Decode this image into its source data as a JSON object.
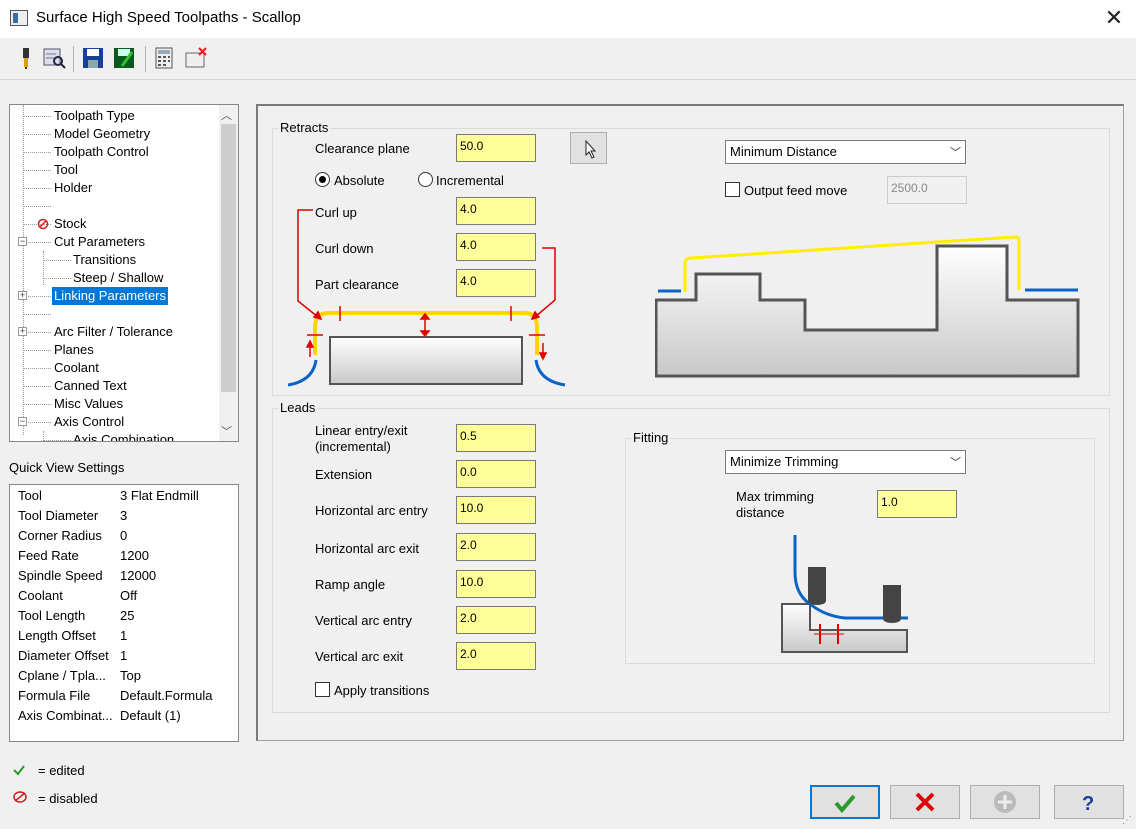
{
  "window": {
    "title": "Surface High Speed Toolpaths - Scallop",
    "close_icon": "close-icon"
  },
  "toolbar": {
    "icons": [
      "tool-icon",
      "preview-icon",
      "save-icon",
      "save-load-icon",
      "calculator-icon",
      "clear-icon"
    ]
  },
  "tree": {
    "items": [
      {
        "label": "Toolpath Type"
      },
      {
        "label": "Model Geometry"
      },
      {
        "label": "Toolpath Control"
      },
      {
        "label": "Tool"
      },
      {
        "label": "Holder"
      },
      {
        "label": ""
      },
      {
        "label": "Stock"
      },
      {
        "label": "Cut Parameters"
      },
      {
        "label": "Transitions"
      },
      {
        "label": "Steep / Shallow"
      },
      {
        "label": "Linking Parameters"
      },
      {
        "label": ""
      },
      {
        "label": "Arc Filter / Tolerance"
      },
      {
        "label": "Planes"
      },
      {
        "label": "Coolant"
      },
      {
        "label": "Canned Text"
      },
      {
        "label": "Misc Values"
      },
      {
        "label": "Axis Control"
      },
      {
        "label": "Axis Combination"
      }
    ]
  },
  "quick_view": {
    "title": "Quick View Settings",
    "rows": [
      {
        "k": "Tool",
        "v": "3 Flat Endmill"
      },
      {
        "k": "Tool Diameter",
        "v": "3"
      },
      {
        "k": "Corner Radius",
        "v": "0"
      },
      {
        "k": "Feed Rate",
        "v": "1200"
      },
      {
        "k": "Spindle Speed",
        "v": "12000"
      },
      {
        "k": "Coolant",
        "v": "Off"
      },
      {
        "k": "Tool Length",
        "v": "25"
      },
      {
        "k": "Length Offset",
        "v": "1"
      },
      {
        "k": "Diameter Offset",
        "v": "1"
      },
      {
        "k": "Cplane / Tpla...",
        "v": "Top"
      },
      {
        "k": "Formula File",
        "v": "Default.Formula"
      },
      {
        "k": "Axis Combinat...",
        "v": "Default (1)"
      }
    ]
  },
  "legend": {
    "edited": "= edited",
    "disabled": "= disabled"
  },
  "retracts": {
    "title": "Retracts",
    "clearance_label": "Clearance plane",
    "clearance_value": "50.0",
    "absolute": "Absolute",
    "incremental": "Incremental",
    "curl_up_label": "Curl up",
    "curl_up_value": "4.0",
    "curl_down_label": "Curl down",
    "curl_down_value": "4.0",
    "part_clearance_label": "Part clearance",
    "part_clearance_value": "4.0",
    "method": "Minimum Distance",
    "output_feed_label": "Output feed move",
    "output_feed_value": "2500.0"
  },
  "leads": {
    "title": "Leads",
    "linear_label": "Linear entry/exit",
    "linear_label2": "(incremental)",
    "linear_value": "0.5",
    "extension_label": "Extension",
    "extension_value": "0.0",
    "h_entry_label": "Horizontal arc entry",
    "h_entry_value": "10.0",
    "h_exit_label": "Horizontal arc exit",
    "h_exit_value": "2.0",
    "ramp_label": "Ramp angle",
    "ramp_value": "10.0",
    "v_entry_label": "Vertical arc entry",
    "v_entry_value": "2.0",
    "v_exit_label": "Vertical arc exit",
    "v_exit_value": "2.0",
    "apply_transitions": "Apply transitions"
  },
  "fitting": {
    "title": "Fitting",
    "method": "Minimize Trimming",
    "max_trim_label": "Max trimming",
    "max_trim_label2": "distance",
    "max_trim_value": "1.0"
  },
  "colors": {
    "input_bg": "#ffff99",
    "selection": "#0078d7",
    "path": "#ffd400",
    "lead": "#0a64c8",
    "marker": "#e00000"
  }
}
